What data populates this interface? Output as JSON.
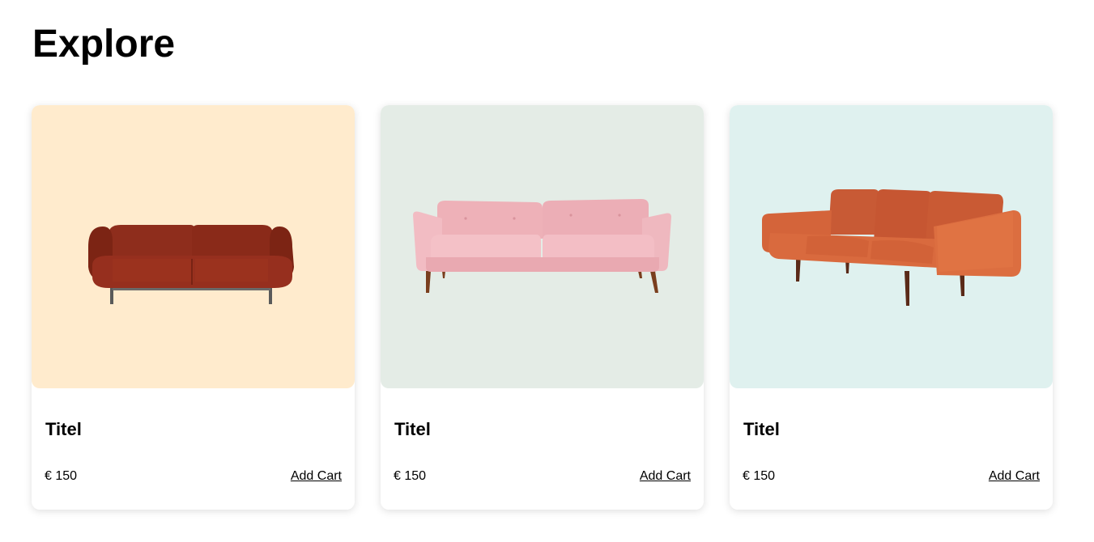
{
  "page": {
    "title": "Explore"
  },
  "products": [
    {
      "title": "Titel",
      "price": "€ 150",
      "cart_label": "Add Cart",
      "image_bg": "#ffebcd",
      "image_name": "dark-red-sofa"
    },
    {
      "title": "Titel",
      "price": "€ 150",
      "cart_label": "Add Cart",
      "image_bg": "#e4ece6",
      "image_name": "pink-sofa"
    },
    {
      "title": "Titel",
      "price": "€ 150",
      "cart_label": "Add Cart",
      "image_bg": "#dff1ef",
      "image_name": "orange-leather-sofa"
    }
  ]
}
